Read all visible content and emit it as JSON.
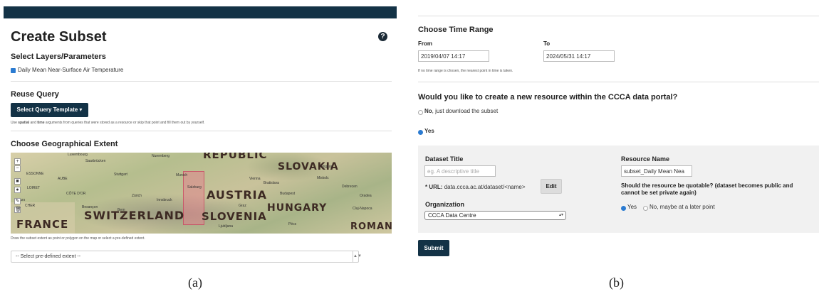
{
  "panel_a": {
    "title": "Create Subset",
    "help_icon": "?",
    "layers": {
      "heading": "Select Layers/Parameters",
      "item_label": "Daily Mean Near-Surface Air Temperature",
      "checked": true
    },
    "reuse": {
      "heading": "Reuse Query",
      "button_label": "Select Query Template ▾",
      "hint_pre": "Use ",
      "hint_bold1": "spatial",
      "hint_mid": " and ",
      "hint_bold2": "time",
      "hint_post": " arguments from queries that were stored as a resource or skip that point and fill them out by yourself."
    },
    "extent": {
      "heading": "Choose Geographical Extent",
      "map_countries": [
        "REPUBLIC",
        "SLOVAKIA",
        "AUSTRIA",
        "HUNGARY",
        "SWITZERLAND",
        "SLOVENIA",
        "FRANCE",
        "ROMANI"
      ],
      "map_cities": [
        "Luxembourg",
        "Nuremberg",
        "Saarbrücken",
        "Stuttgart",
        "Munich",
        "Vienna",
        "Bratislava",
        "Ungvár",
        "Miskolc",
        "Debrecen",
        "Budapest",
        "ESSONNE",
        "AUBE",
        "LOIRET",
        "CÔTE D'OR",
        "CHER",
        "Besançon",
        "Bern",
        "Zürich",
        "Salzburg",
        "Graz",
        "Ljubljana",
        "Pécs",
        "Cluj-Napoca",
        "Oradea",
        "Tours",
        "Innsbruck"
      ],
      "map_controls": [
        "+",
        "−",
        "■",
        "●",
        "✎",
        "🗑"
      ],
      "hint": "Draw the subset extent as point or polygon on the map or select a pre-defined extent.",
      "select_placeholder": "-- Select pre-defined extent --",
      "select_caret": "▲▼"
    },
    "caption": "(a)"
  },
  "panel_b": {
    "time": {
      "heading": "Choose Time Range",
      "from_label": "From",
      "from_value": "2019/04/07 14:17",
      "to_label": "To",
      "to_value": "2024/05/31 14:17",
      "hint": "If no time range is chosen, the nearest point in time is taken."
    },
    "resource": {
      "question": "Would you like to create a new resource within the CCCA data portal?",
      "option_no_bold": "No",
      "option_no_rest": ", just download the subset",
      "option_yes": "Yes",
      "selected": "Yes"
    },
    "form": {
      "dataset_title_label": "Dataset Title",
      "dataset_title_placeholder": "eg. A descriptive title",
      "url_label": "* URL:",
      "url_value": "data.ccca.ac.at/dataset/<name>",
      "edit_label": "Edit",
      "organization_label": "Organization",
      "organization_value": "CCCA Data Centre",
      "resource_name_label": "Resource Name",
      "resource_name_value": "subset_Daily Mean Nea",
      "quotable_question_line1": "Should the resource be quotable? (dataset becomes public and",
      "quotable_question_line2": "cannot be set private again)",
      "quotable_yes": "Yes",
      "quotable_no": "No, maybe at a later point",
      "quotable_selected": "Yes"
    },
    "submit_label": "Submit",
    "caption": "(b)"
  }
}
